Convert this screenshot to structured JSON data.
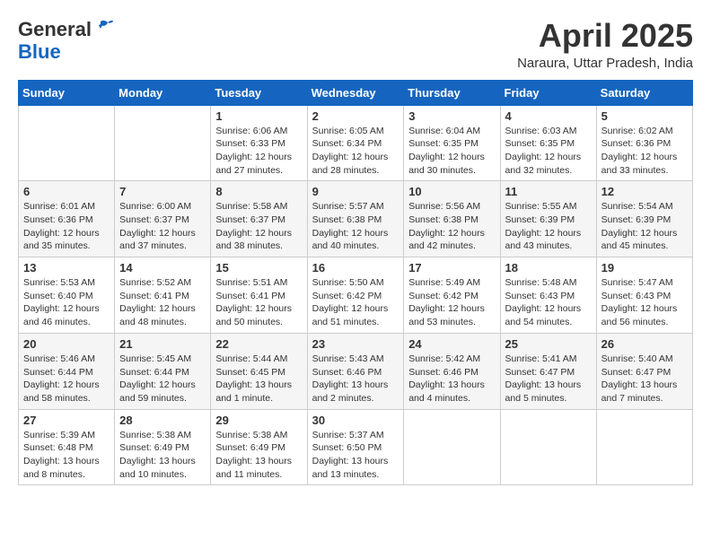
{
  "header": {
    "logo_line1": "General",
    "logo_line2": "Blue",
    "month": "April 2025",
    "location": "Naraura, Uttar Pradesh, India"
  },
  "calendar": {
    "days_of_week": [
      "Sunday",
      "Monday",
      "Tuesday",
      "Wednesday",
      "Thursday",
      "Friday",
      "Saturday"
    ],
    "weeks": [
      [
        {
          "day": "",
          "info": ""
        },
        {
          "day": "",
          "info": ""
        },
        {
          "day": "1",
          "info": "Sunrise: 6:06 AM\nSunset: 6:33 PM\nDaylight: 12 hours\nand 27 minutes."
        },
        {
          "day": "2",
          "info": "Sunrise: 6:05 AM\nSunset: 6:34 PM\nDaylight: 12 hours\nand 28 minutes."
        },
        {
          "day": "3",
          "info": "Sunrise: 6:04 AM\nSunset: 6:35 PM\nDaylight: 12 hours\nand 30 minutes."
        },
        {
          "day": "4",
          "info": "Sunrise: 6:03 AM\nSunset: 6:35 PM\nDaylight: 12 hours\nand 32 minutes."
        },
        {
          "day": "5",
          "info": "Sunrise: 6:02 AM\nSunset: 6:36 PM\nDaylight: 12 hours\nand 33 minutes."
        }
      ],
      [
        {
          "day": "6",
          "info": "Sunrise: 6:01 AM\nSunset: 6:36 PM\nDaylight: 12 hours\nand 35 minutes."
        },
        {
          "day": "7",
          "info": "Sunrise: 6:00 AM\nSunset: 6:37 PM\nDaylight: 12 hours\nand 37 minutes."
        },
        {
          "day": "8",
          "info": "Sunrise: 5:58 AM\nSunset: 6:37 PM\nDaylight: 12 hours\nand 38 minutes."
        },
        {
          "day": "9",
          "info": "Sunrise: 5:57 AM\nSunset: 6:38 PM\nDaylight: 12 hours\nand 40 minutes."
        },
        {
          "day": "10",
          "info": "Sunrise: 5:56 AM\nSunset: 6:38 PM\nDaylight: 12 hours\nand 42 minutes."
        },
        {
          "day": "11",
          "info": "Sunrise: 5:55 AM\nSunset: 6:39 PM\nDaylight: 12 hours\nand 43 minutes."
        },
        {
          "day": "12",
          "info": "Sunrise: 5:54 AM\nSunset: 6:39 PM\nDaylight: 12 hours\nand 45 minutes."
        }
      ],
      [
        {
          "day": "13",
          "info": "Sunrise: 5:53 AM\nSunset: 6:40 PM\nDaylight: 12 hours\nand 46 minutes."
        },
        {
          "day": "14",
          "info": "Sunrise: 5:52 AM\nSunset: 6:41 PM\nDaylight: 12 hours\nand 48 minutes."
        },
        {
          "day": "15",
          "info": "Sunrise: 5:51 AM\nSunset: 6:41 PM\nDaylight: 12 hours\nand 50 minutes."
        },
        {
          "day": "16",
          "info": "Sunrise: 5:50 AM\nSunset: 6:42 PM\nDaylight: 12 hours\nand 51 minutes."
        },
        {
          "day": "17",
          "info": "Sunrise: 5:49 AM\nSunset: 6:42 PM\nDaylight: 12 hours\nand 53 minutes."
        },
        {
          "day": "18",
          "info": "Sunrise: 5:48 AM\nSunset: 6:43 PM\nDaylight: 12 hours\nand 54 minutes."
        },
        {
          "day": "19",
          "info": "Sunrise: 5:47 AM\nSunset: 6:43 PM\nDaylight: 12 hours\nand 56 minutes."
        }
      ],
      [
        {
          "day": "20",
          "info": "Sunrise: 5:46 AM\nSunset: 6:44 PM\nDaylight: 12 hours\nand 58 minutes."
        },
        {
          "day": "21",
          "info": "Sunrise: 5:45 AM\nSunset: 6:44 PM\nDaylight: 12 hours\nand 59 minutes."
        },
        {
          "day": "22",
          "info": "Sunrise: 5:44 AM\nSunset: 6:45 PM\nDaylight: 13 hours\nand 1 minute."
        },
        {
          "day": "23",
          "info": "Sunrise: 5:43 AM\nSunset: 6:46 PM\nDaylight: 13 hours\nand 2 minutes."
        },
        {
          "day": "24",
          "info": "Sunrise: 5:42 AM\nSunset: 6:46 PM\nDaylight: 13 hours\nand 4 minutes."
        },
        {
          "day": "25",
          "info": "Sunrise: 5:41 AM\nSunset: 6:47 PM\nDaylight: 13 hours\nand 5 minutes."
        },
        {
          "day": "26",
          "info": "Sunrise: 5:40 AM\nSunset: 6:47 PM\nDaylight: 13 hours\nand 7 minutes."
        }
      ],
      [
        {
          "day": "27",
          "info": "Sunrise: 5:39 AM\nSunset: 6:48 PM\nDaylight: 13 hours\nand 8 minutes."
        },
        {
          "day": "28",
          "info": "Sunrise: 5:38 AM\nSunset: 6:49 PM\nDaylight: 13 hours\nand 10 minutes."
        },
        {
          "day": "29",
          "info": "Sunrise: 5:38 AM\nSunset: 6:49 PM\nDaylight: 13 hours\nand 11 minutes."
        },
        {
          "day": "30",
          "info": "Sunrise: 5:37 AM\nSunset: 6:50 PM\nDaylight: 13 hours\nand 13 minutes."
        },
        {
          "day": "",
          "info": ""
        },
        {
          "day": "",
          "info": ""
        },
        {
          "day": "",
          "info": ""
        }
      ]
    ]
  }
}
